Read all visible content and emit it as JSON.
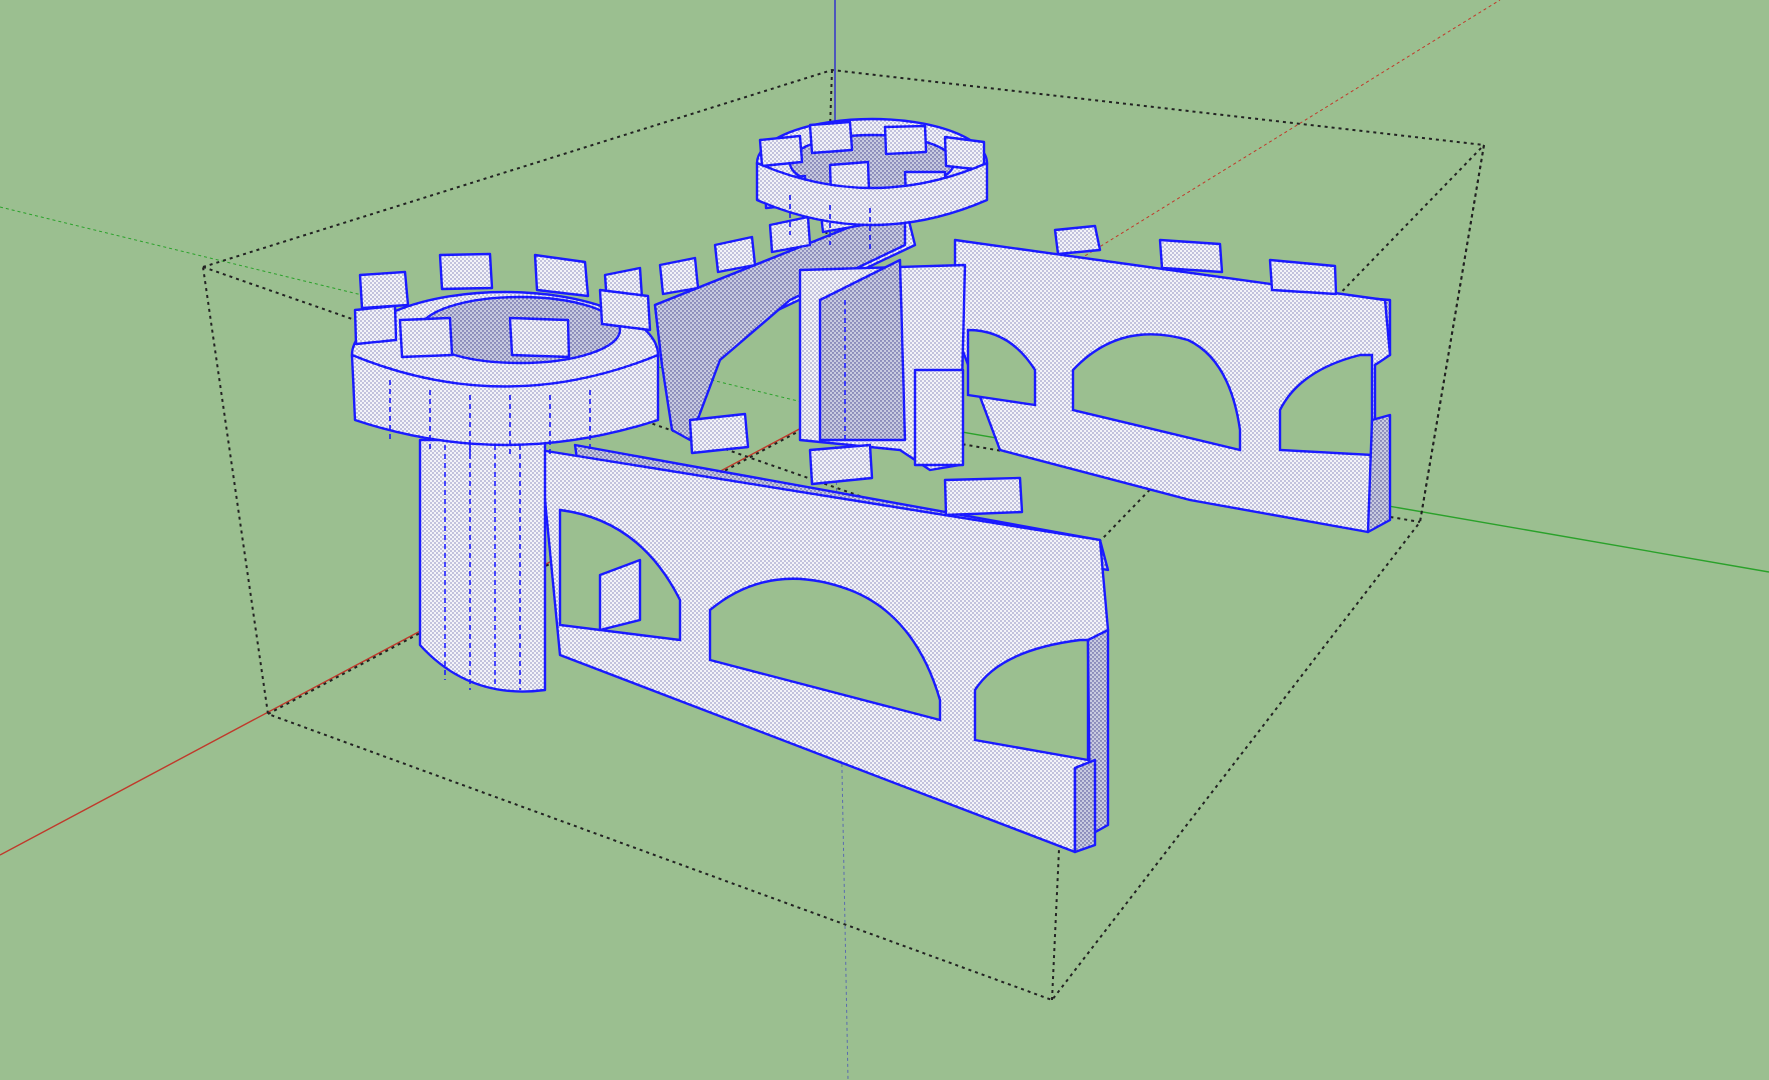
{
  "app": {
    "name": "",
    "mode": "3d-modeling-viewport"
  },
  "scene": {
    "background_color": "#9bbf90",
    "selection_edge_color": "#1a1aff",
    "face_fill_color": "#f4f4f8",
    "face_shade_color": "#c9cbe0",
    "bounding_box_color": "#222222",
    "axes": {
      "red": "#c0392b",
      "green": "#2aa12a",
      "blue": "#2a2ad0"
    },
    "model_description_icon": "castle-model"
  }
}
